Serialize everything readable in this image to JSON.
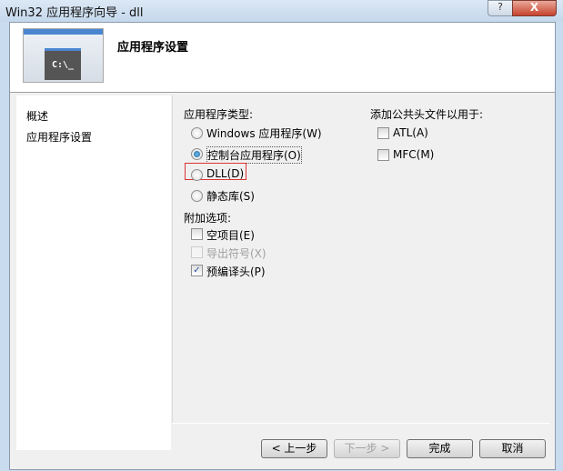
{
  "window": {
    "title": "Win32 应用程序向导 - dll",
    "help": "?",
    "close": "X"
  },
  "header": {
    "title": "应用程序设置",
    "logo_text": "C:\\_"
  },
  "sidebar": {
    "items": [
      {
        "label": "概述"
      },
      {
        "label": "应用程序设置"
      }
    ]
  },
  "app_type": {
    "label": "应用程序类型:",
    "options": [
      {
        "label": "Windows 应用程序(W)",
        "selected": false
      },
      {
        "label": "控制台应用程序(O)",
        "selected": true
      },
      {
        "label": "DLL(D)",
        "selected": false
      },
      {
        "label": "静态库(S)",
        "selected": false
      }
    ]
  },
  "extra": {
    "label": "附加选项:",
    "options": [
      {
        "label": "空项目(E)",
        "checked": false,
        "enabled": true
      },
      {
        "label": "导出符号(X)",
        "checked": false,
        "enabled": false
      },
      {
        "label": "预编译头(P)",
        "checked": true,
        "enabled": true
      }
    ]
  },
  "headers": {
    "label": "添加公共头文件以用于:",
    "options": [
      {
        "label": "ATL(A)",
        "checked": false
      },
      {
        "label": "MFC(M)",
        "checked": false
      }
    ]
  },
  "buttons": {
    "prev": "< 上一步",
    "next": "下一步 >",
    "finish": "完成",
    "cancel": "取消"
  }
}
